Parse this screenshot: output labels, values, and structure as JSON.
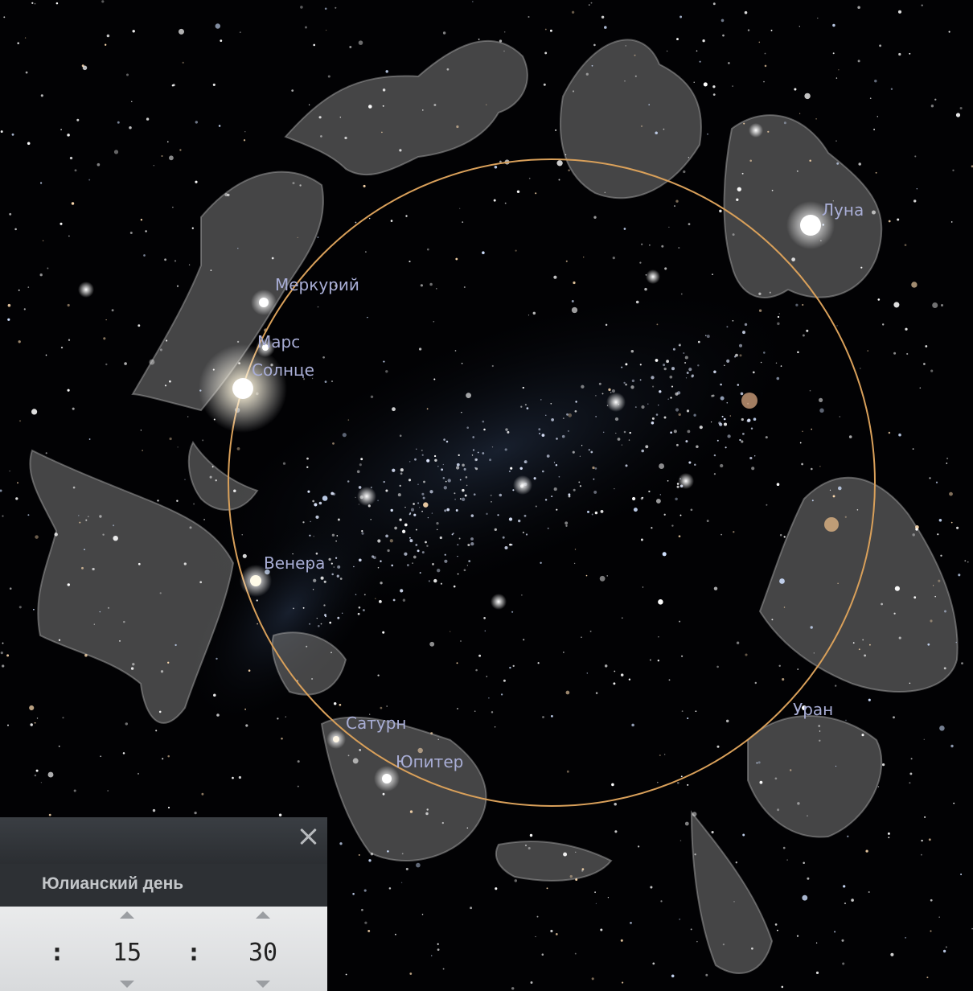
{
  "sky": {
    "planets": [
      {
        "id": "mercury",
        "label": "Меркурий"
      },
      {
        "id": "mars",
        "label": "Марс"
      },
      {
        "id": "sun",
        "label": "Солнце"
      },
      {
        "id": "venus",
        "label": "Венера"
      },
      {
        "id": "saturn",
        "label": "Сатурн"
      },
      {
        "id": "jupiter",
        "label": "Юпитер"
      },
      {
        "id": "uranus",
        "label": "Уран"
      },
      {
        "id": "moon",
        "label": "Луна"
      }
    ],
    "ecliptic_color": "#d9a05a"
  },
  "dialog": {
    "title": "Юлианский день",
    "separator": ":",
    "minutes": "15",
    "seconds": "30"
  }
}
